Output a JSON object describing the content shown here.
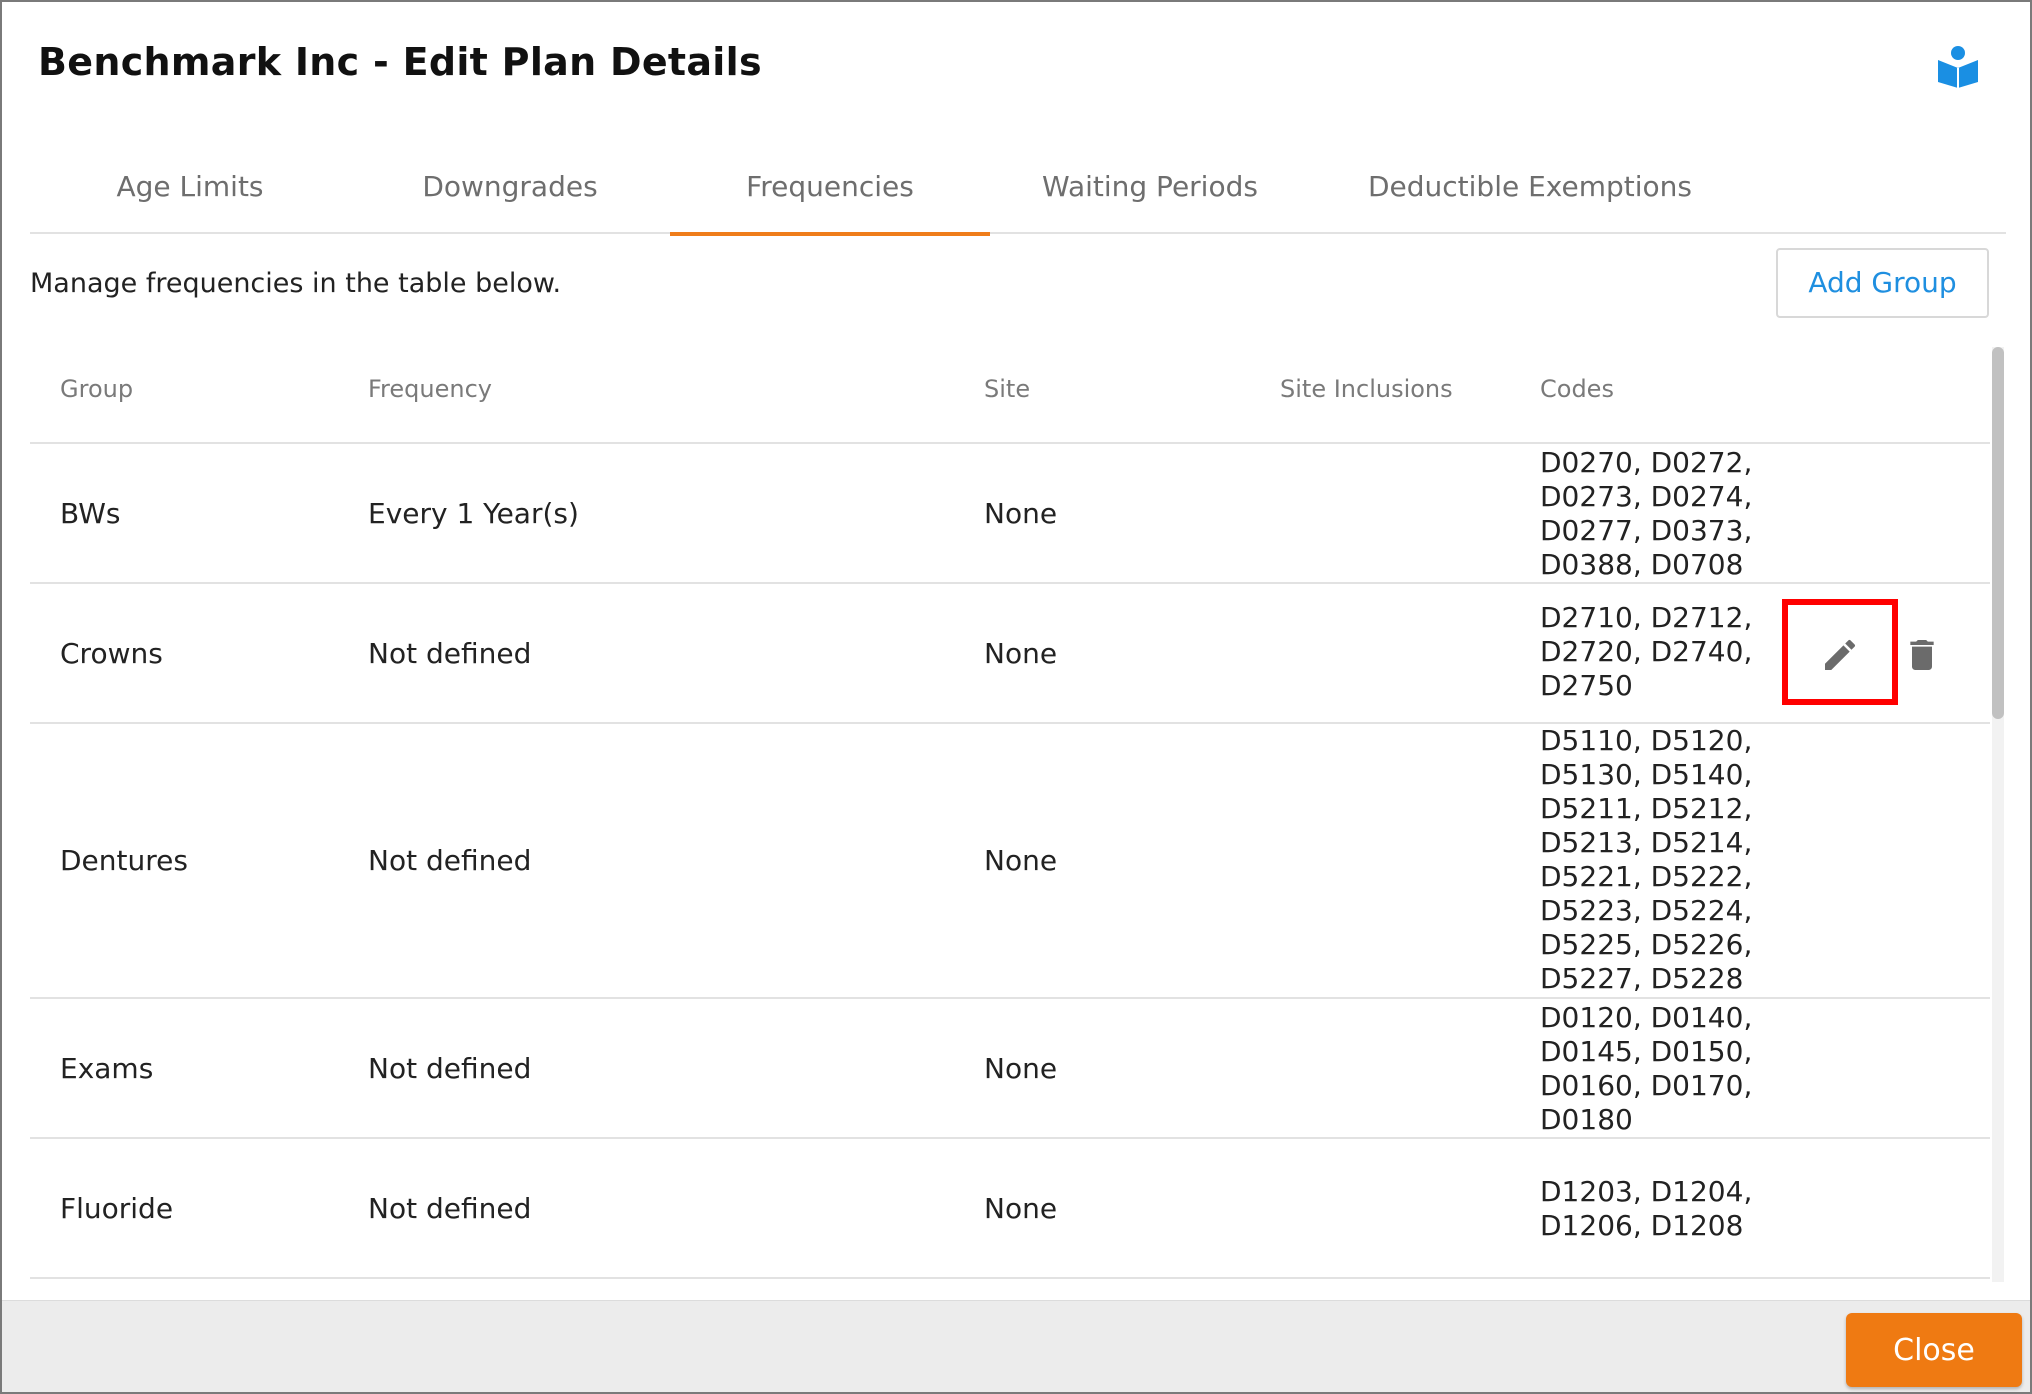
{
  "dialog": {
    "title": "Benchmark Inc - Edit Plan Details",
    "help_icon": "book-reader-icon"
  },
  "tabs": [
    {
      "label": "Age Limits",
      "active": false
    },
    {
      "label": "Downgrades",
      "active": false
    },
    {
      "label": "Frequencies",
      "active": true
    },
    {
      "label": "Waiting Periods",
      "active": false
    },
    {
      "label": "Deductible Exemptions",
      "active": false
    }
  ],
  "content": {
    "hint": "Manage frequencies in the table below.",
    "add_group_label": "Add Group"
  },
  "table": {
    "headers": {
      "group": "Group",
      "frequency": "Frequency",
      "site": "Site",
      "site_inclusions": "Site Inclusions",
      "codes": "Codes"
    },
    "rows": [
      {
        "group": "BWs",
        "frequency": "Every 1 Year(s)",
        "site": "None",
        "site_inclusions": "",
        "codes": "D0270, D0272,\nD0273, D0274,\nD0277, D0373,\nD0388, D0708"
      },
      {
        "group": "Crowns",
        "frequency": "Not defined",
        "site": "None",
        "site_inclusions": "",
        "codes": "D2710, D2712,\nD2720, D2740,\nD2750"
      },
      {
        "group": "Dentures",
        "frequency": "Not defined",
        "site": "None",
        "site_inclusions": "",
        "codes": "D5110, D5120,\nD5130, D5140,\nD5211, D5212,\nD5213, D5214,\nD5221, D5222,\nD5223, D5224,\nD5225, D5226,\nD5227, D5228"
      },
      {
        "group": "Exams",
        "frequency": "Not defined",
        "site": "None",
        "site_inclusions": "",
        "codes": "D0120, D0140,\nD0145, D0150,\nD0160, D0170,\nD0180"
      },
      {
        "group": "Fluoride",
        "frequency": "Not defined",
        "site": "None",
        "site_inclusions": "",
        "codes": "D1203, D1204,\nD1206, D1208"
      }
    ],
    "row_actions": {
      "edit_icon": "pencil-icon",
      "delete_icon": "trash-icon"
    }
  },
  "footer": {
    "close_label": "Close"
  },
  "colors": {
    "accent_orange": "#ef7a12",
    "tab_underline": "#ef7d1a",
    "link_blue": "#1f8fe0",
    "highlight_red": "#ff0000",
    "icon_blue": "#1a8fe3",
    "icon_gray": "#6b6b6b"
  }
}
